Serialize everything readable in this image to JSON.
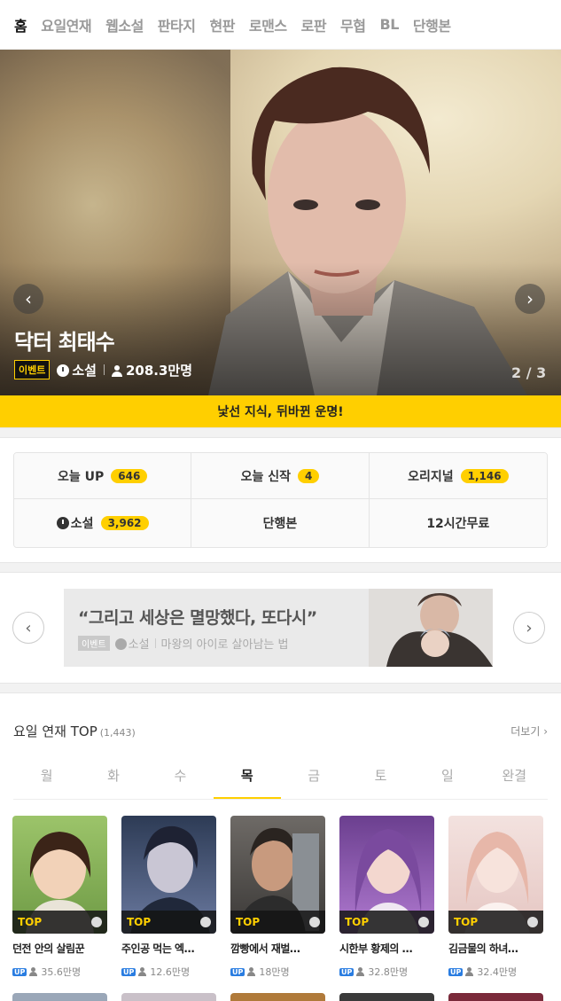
{
  "nav": {
    "tabs": [
      "홈",
      "요일연재",
      "웹소설",
      "판타지",
      "현판",
      "로맨스",
      "로판",
      "무협",
      "BL",
      "단행본"
    ]
  },
  "hero": {
    "title": "닥터 최태수",
    "badge": "이벤트",
    "category": "소설",
    "views": "208.3만명",
    "pager": "2 / 3",
    "prev_icon": "‹",
    "next_icon": "›"
  },
  "banner": {
    "text": "낯선 지식, 뒤바뀐 운명!"
  },
  "stats": {
    "today_up": {
      "label": "오늘 UP",
      "count": "646"
    },
    "today_new": {
      "label": "오늘 신작",
      "count": "4"
    },
    "original": {
      "label": "오리지널",
      "count": "1,146"
    },
    "novel": {
      "label": "소설",
      "count": "3,962"
    },
    "single": {
      "label": "단행본"
    },
    "free12": {
      "label": "12시간무료"
    }
  },
  "promo": {
    "quote": "“그리고 세상은 멸망했다, 또다시”",
    "badge": "이벤트",
    "category": "소설",
    "title": "마왕의 아이로 살아남는 법",
    "prev_icon": "‹",
    "next_icon": "›"
  },
  "top_section": {
    "title": "요일 연재 TOP",
    "count": "(1,443)",
    "more": "더보기 ›",
    "days": [
      "월",
      "화",
      "수",
      "목",
      "금",
      "토",
      "일",
      "완결"
    ],
    "active_day": "목"
  },
  "books": [
    {
      "label": "TOP",
      "title": "던전 안의 살림꾼",
      "up": "UP",
      "views": "35.6만명"
    },
    {
      "label": "TOP",
      "title": "주인공 먹는 엑…",
      "up": "UP",
      "views": "12.6만명"
    },
    {
      "label": "TOP",
      "title": "깜빵에서 재벌…",
      "up": "UP",
      "views": "18만명"
    },
    {
      "label": "TOP",
      "title": "시한부 황제의 …",
      "up": "UP",
      "views": "32.8만명"
    },
    {
      "label": "TOP",
      "title": "김금물의 하녀…",
      "up": "UP",
      "views": "32.4만명"
    }
  ],
  "colors": {
    "accent": "#ffcf00",
    "up_badge": "#2a7de1"
  }
}
